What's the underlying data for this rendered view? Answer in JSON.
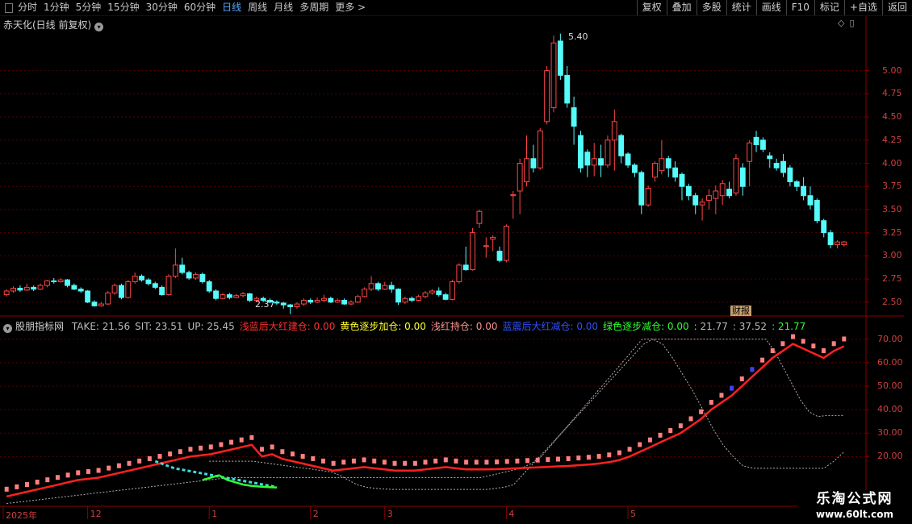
{
  "toolbar": {
    "periods": [
      {
        "label": "分时",
        "active": false
      },
      {
        "label": "1分钟",
        "active": false
      },
      {
        "label": "5分钟",
        "active": false
      },
      {
        "label": "15分钟",
        "active": false
      },
      {
        "label": "30分钟",
        "active": false
      },
      {
        "label": "60分钟",
        "active": false
      },
      {
        "label": "日线",
        "active": true
      },
      {
        "label": "周线",
        "active": false
      },
      {
        "label": "月线",
        "active": false
      },
      {
        "label": "多周期",
        "active": false
      },
      {
        "label": "更多 >",
        "active": false
      }
    ],
    "buttons": [
      "复权",
      "叠加",
      "多股",
      "统计",
      "画线",
      "F10",
      "标记",
      "+自选",
      "返回"
    ]
  },
  "main_pane": {
    "title": "赤天化(日线 前复权)",
    "high_mark": "5.40",
    "low_mark": "2.37",
    "fin_tag": "财报"
  },
  "indicator_pane": {
    "name": "股朋指标网",
    "items": [
      {
        "text": "TAKE: 21.56",
        "color": "#bbbbbb"
      },
      {
        "text": "SIT: 23.51",
        "color": "#bbbbbb"
      },
      {
        "text": "UP: 25.45",
        "color": "#bbbbbb"
      },
      {
        "text": "浅蓝后大红建仓: 0.00",
        "color": "#ff3030"
      },
      {
        "text": "黄色逐步加仓: 0.00",
        "color": "#ffff30"
      },
      {
        "text": "浅红持仓: 0.00",
        "color": "#ff9090"
      },
      {
        "text": "蓝震后大红减仓: 0.00",
        "color": "#3050ff"
      },
      {
        "text": "绿色逐步减仓: 0.00",
        "color": "#30ff30"
      },
      {
        "text": ": 21.77",
        "color": "#bbbbbb"
      },
      {
        "text": ": 37.52",
        "color": "#bbbbbb"
      },
      {
        "text": ": 21.77",
        "color": "#30ff30"
      }
    ]
  },
  "price_axis": [
    "5.00",
    "4.75",
    "4.50",
    "4.25",
    "4.00",
    "3.75",
    "3.50",
    "3.25",
    "3.00",
    "2.75",
    "2.50"
  ],
  "indicator_axis": [
    "70.00",
    "60.00",
    "50.00",
    "40.00",
    "30.00",
    "20.00"
  ],
  "date_axis": [
    {
      "label": "2025年"
    },
    {
      "label": "12"
    },
    {
      "label": "1"
    },
    {
      "label": "2"
    },
    {
      "label": "3"
    },
    {
      "label": "4"
    },
    {
      "label": "5"
    }
  ],
  "watermark": {
    "title": "乐淘公式网",
    "url": "www.60lt.com"
  },
  "colors": {
    "up": "#ff4545",
    "down": "#54fcfc",
    "grid": "#5a0000",
    "frame": "#8b0000"
  },
  "chart_data": {
    "type": "candlestick",
    "ylim": [
      2.35,
      5.45
    ],
    "bars": [
      {
        "o": 2.58,
        "c": 2.62,
        "h": 2.64,
        "l": 2.56
      },
      {
        "o": 2.62,
        "c": 2.65,
        "h": 2.67,
        "l": 2.6
      },
      {
        "o": 2.65,
        "c": 2.63,
        "h": 2.68,
        "l": 2.61
      },
      {
        "o": 2.63,
        "c": 2.66,
        "h": 2.7,
        "l": 2.62
      },
      {
        "o": 2.66,
        "c": 2.64,
        "h": 2.68,
        "l": 2.62
      },
      {
        "o": 2.64,
        "c": 2.68,
        "h": 2.7,
        "l": 2.63
      },
      {
        "o": 2.68,
        "c": 2.73,
        "h": 2.74,
        "l": 2.66
      },
      {
        "o": 2.73,
        "c": 2.72,
        "h": 2.76,
        "l": 2.7
      },
      {
        "o": 2.72,
        "c": 2.74,
        "h": 2.76,
        "l": 2.71
      },
      {
        "o": 2.74,
        "c": 2.68,
        "h": 2.75,
        "l": 2.66
      },
      {
        "o": 2.68,
        "c": 2.64,
        "h": 2.7,
        "l": 2.63
      },
      {
        "o": 2.64,
        "c": 2.62,
        "h": 2.66,
        "l": 2.6
      },
      {
        "o": 2.62,
        "c": 2.5,
        "h": 2.63,
        "l": 2.49
      },
      {
        "o": 2.5,
        "c": 2.46,
        "h": 2.52,
        "l": 2.45
      },
      {
        "o": 2.46,
        "c": 2.48,
        "h": 2.5,
        "l": 2.45
      },
      {
        "o": 2.48,
        "c": 2.6,
        "h": 2.62,
        "l": 2.47
      },
      {
        "o": 2.6,
        "c": 2.68,
        "h": 2.7,
        "l": 2.58
      },
      {
        "o": 2.68,
        "c": 2.55,
        "h": 2.7,
        "l": 2.53
      },
      {
        "o": 2.55,
        "c": 2.72,
        "h": 2.74,
        "l": 2.54
      },
      {
        "o": 2.72,
        "c": 2.78,
        "h": 2.82,
        "l": 2.7
      },
      {
        "o": 2.78,
        "c": 2.74,
        "h": 2.8,
        "l": 2.72
      },
      {
        "o": 2.74,
        "c": 2.7,
        "h": 2.76,
        "l": 2.68
      },
      {
        "o": 2.7,
        "c": 2.66,
        "h": 2.72,
        "l": 2.64
      },
      {
        "o": 2.66,
        "c": 2.58,
        "h": 2.68,
        "l": 2.57
      },
      {
        "o": 2.58,
        "c": 2.78,
        "h": 2.8,
        "l": 2.57
      },
      {
        "o": 2.78,
        "c": 2.9,
        "h": 3.08,
        "l": 2.76
      },
      {
        "o": 2.9,
        "c": 2.82,
        "h": 2.98,
        "l": 2.8
      },
      {
        "o": 2.82,
        "c": 2.76,
        "h": 2.84,
        "l": 2.74
      },
      {
        "o": 2.76,
        "c": 2.8,
        "h": 2.82,
        "l": 2.74
      },
      {
        "o": 2.8,
        "c": 2.72,
        "h": 2.82,
        "l": 2.7
      },
      {
        "o": 2.72,
        "c": 2.62,
        "h": 2.74,
        "l": 2.6
      },
      {
        "o": 2.62,
        "c": 2.54,
        "h": 2.64,
        "l": 2.52
      },
      {
        "o": 2.54,
        "c": 2.58,
        "h": 2.6,
        "l": 2.53
      },
      {
        "o": 2.58,
        "c": 2.55,
        "h": 2.6,
        "l": 2.53
      },
      {
        "o": 2.55,
        "c": 2.57,
        "h": 2.59,
        "l": 2.54
      },
      {
        "o": 2.57,
        "c": 2.59,
        "h": 2.61,
        "l": 2.55
      },
      {
        "o": 2.59,
        "c": 2.52,
        "h": 2.6,
        "l": 2.5
      },
      {
        "o": 2.52,
        "c": 2.54,
        "h": 2.56,
        "l": 2.5
      },
      {
        "o": 2.54,
        "c": 2.52,
        "h": 2.56,
        "l": 2.5
      },
      {
        "o": 2.52,
        "c": 2.5,
        "h": 2.54,
        "l": 2.49
      },
      {
        "o": 2.5,
        "c": 2.49,
        "h": 2.52,
        "l": 2.47
      },
      {
        "o": 2.49,
        "c": 2.47,
        "h": 2.5,
        "l": 2.43
      },
      {
        "o": 2.47,
        "c": 2.45,
        "h": 2.48,
        "l": 2.37
      },
      {
        "o": 2.45,
        "c": 2.48,
        "h": 2.5,
        "l": 2.43
      },
      {
        "o": 2.48,
        "c": 2.52,
        "h": 2.54,
        "l": 2.46
      },
      {
        "o": 2.52,
        "c": 2.5,
        "h": 2.54,
        "l": 2.48
      },
      {
        "o": 2.5,
        "c": 2.52,
        "h": 2.55,
        "l": 2.49
      },
      {
        "o": 2.52,
        "c": 2.54,
        "h": 2.58,
        "l": 2.5
      },
      {
        "o": 2.54,
        "c": 2.5,
        "h": 2.56,
        "l": 2.49
      },
      {
        "o": 2.5,
        "c": 2.52,
        "h": 2.54,
        "l": 2.49
      },
      {
        "o": 2.52,
        "c": 2.48,
        "h": 2.54,
        "l": 2.47
      },
      {
        "o": 2.48,
        "c": 2.5,
        "h": 2.52,
        "l": 2.47
      },
      {
        "o": 2.5,
        "c": 2.56,
        "h": 2.58,
        "l": 2.49
      },
      {
        "o": 2.56,
        "c": 2.64,
        "h": 2.66,
        "l": 2.55
      },
      {
        "o": 2.64,
        "c": 2.7,
        "h": 2.78,
        "l": 2.62
      },
      {
        "o": 2.7,
        "c": 2.64,
        "h": 2.72,
        "l": 2.62
      },
      {
        "o": 2.64,
        "c": 2.68,
        "h": 2.72,
        "l": 2.63
      },
      {
        "o": 2.68,
        "c": 2.64,
        "h": 2.72,
        "l": 2.6
      },
      {
        "o": 2.64,
        "c": 2.5,
        "h": 2.65,
        "l": 2.47
      },
      {
        "o": 2.5,
        "c": 2.54,
        "h": 2.56,
        "l": 2.48
      },
      {
        "o": 2.54,
        "c": 2.52,
        "h": 2.56,
        "l": 2.5
      },
      {
        "o": 2.52,
        "c": 2.56,
        "h": 2.58,
        "l": 2.51
      },
      {
        "o": 2.56,
        "c": 2.6,
        "h": 2.62,
        "l": 2.54
      },
      {
        "o": 2.6,
        "c": 2.62,
        "h": 2.64,
        "l": 2.58
      },
      {
        "o": 2.62,
        "c": 2.58,
        "h": 2.66,
        "l": 2.56
      },
      {
        "o": 2.58,
        "c": 2.53,
        "h": 2.6,
        "l": 2.52
      },
      {
        "o": 2.53,
        "c": 2.72,
        "h": 2.74,
        "l": 2.52
      },
      {
        "o": 2.72,
        "c": 2.9,
        "h": 2.92,
        "l": 2.7
      },
      {
        "o": 2.9,
        "c": 2.85,
        "h": 3.1,
        "l": 2.84
      },
      {
        "o": 2.85,
        "c": 3.25,
        "h": 3.3,
        "l": 2.84
      },
      {
        "o": 3.35,
        "c": 3.48,
        "h": 3.5,
        "l": 3.3
      },
      {
        "o": 3.1,
        "c": 3.11,
        "h": 3.2,
        "l": 2.98
      },
      {
        "o": 3.18,
        "c": 3.2,
        "h": 3.22,
        "l": 3.05
      },
      {
        "o": 3.05,
        "c": 2.95,
        "h": 3.1,
        "l": 2.93
      },
      {
        "o": 2.95,
        "c": 3.32,
        "h": 3.34,
        "l": 2.93
      },
      {
        "o": 3.65,
        "c": 3.66,
        "h": 3.7,
        "l": 3.4
      },
      {
        "o": 3.7,
        "c": 4.0,
        "h": 4.05,
        "l": 3.45
      },
      {
        "o": 3.8,
        "c": 4.05,
        "h": 4.3,
        "l": 3.75
      },
      {
        "o": 4.05,
        "c": 3.95,
        "h": 4.2,
        "l": 3.9
      },
      {
        "o": 3.95,
        "c": 4.35,
        "h": 4.38,
        "l": 3.93
      },
      {
        "o": 4.45,
        "c": 5.0,
        "h": 5.05,
        "l": 4.42
      },
      {
        "o": 4.6,
        "c": 5.3,
        "h": 5.38,
        "l": 4.55
      },
      {
        "o": 5.32,
        "c": 4.95,
        "h": 5.4,
        "l": 4.9
      },
      {
        "o": 4.95,
        "c": 4.65,
        "h": 5.05,
        "l": 4.6
      },
      {
        "o": 4.6,
        "c": 4.4,
        "h": 4.72,
        "l": 4.2
      },
      {
        "o": 4.3,
        "c": 3.95,
        "h": 4.35,
        "l": 3.9
      },
      {
        "o": 4.12,
        "c": 3.98,
        "h": 4.15,
        "l": 3.85
      },
      {
        "o": 3.98,
        "c": 4.05,
        "h": 4.22,
        "l": 3.86
      },
      {
        "o": 4.05,
        "c": 3.98,
        "h": 4.2,
        "l": 3.85
      },
      {
        "o": 3.98,
        "c": 4.25,
        "h": 4.3,
        "l": 3.95
      },
      {
        "o": 4.25,
        "c": 4.45,
        "h": 4.58,
        "l": 3.92
      },
      {
        "o": 4.3,
        "c": 4.08,
        "h": 4.32,
        "l": 4.0
      },
      {
        "o": 4.1,
        "c": 3.98,
        "h": 4.12,
        "l": 3.95
      },
      {
        "o": 3.98,
        "c": 3.9,
        "h": 4.0,
        "l": 3.85
      },
      {
        "o": 3.9,
        "c": 3.55,
        "h": 3.92,
        "l": 3.45
      },
      {
        "o": 3.55,
        "c": 3.73,
        "h": 3.76,
        "l": 3.53
      },
      {
        "o": 3.85,
        "c": 4.0,
        "h": 4.02,
        "l": 3.8
      },
      {
        "o": 3.92,
        "c": 4.05,
        "h": 4.25,
        "l": 3.88
      },
      {
        "o": 4.05,
        "c": 3.95,
        "h": 4.08,
        "l": 3.85
      },
      {
        "o": 3.95,
        "c": 3.85,
        "h": 4.02,
        "l": 3.8
      },
      {
        "o": 3.88,
        "c": 3.75,
        "h": 3.9,
        "l": 3.6
      },
      {
        "o": 3.75,
        "c": 3.65,
        "h": 3.78,
        "l": 3.6
      },
      {
        "o": 3.65,
        "c": 3.55,
        "h": 3.68,
        "l": 3.45
      },
      {
        "o": 3.55,
        "c": 3.58,
        "h": 3.62,
        "l": 3.38
      },
      {
        "o": 3.6,
        "c": 3.65,
        "h": 3.72,
        "l": 3.5
      },
      {
        "o": 3.62,
        "c": 3.7,
        "h": 3.76,
        "l": 3.45
      },
      {
        "o": 3.65,
        "c": 3.78,
        "h": 3.82,
        "l": 3.55
      },
      {
        "o": 3.72,
        "c": 3.65,
        "h": 3.8,
        "l": 3.62
      },
      {
        "o": 3.68,
        "c": 4.05,
        "h": 4.1,
        "l": 3.65
      },
      {
        "o": 3.95,
        "c": 3.75,
        "h": 4.0,
        "l": 3.65
      },
      {
        "o": 4.02,
        "c": 4.22,
        "h": 4.25,
        "l": 3.75
      },
      {
        "o": 4.28,
        "c": 4.2,
        "h": 4.35,
        "l": 4.12
      },
      {
        "o": 4.25,
        "c": 4.15,
        "h": 4.28,
        "l": 4.12
      },
      {
        "o": 4.08,
        "c": 4.05,
        "h": 4.12,
        "l": 3.95
      },
      {
        "o": 4.0,
        "c": 3.95,
        "h": 4.05,
        "l": 3.92
      },
      {
        "o": 4.02,
        "c": 3.9,
        "h": 4.1,
        "l": 3.85
      },
      {
        "o": 3.95,
        "c": 3.8,
        "h": 3.98,
        "l": 3.75
      },
      {
        "o": 3.8,
        "c": 3.75,
        "h": 3.82,
        "l": 3.7
      },
      {
        "o": 3.75,
        "c": 3.65,
        "h": 3.85,
        "l": 3.6
      },
      {
        "o": 3.65,
        "c": 3.55,
        "h": 3.75,
        "l": 3.5
      },
      {
        "o": 3.6,
        "c": 3.38,
        "h": 3.62,
        "l": 3.35
      },
      {
        "o": 3.38,
        "c": 3.25,
        "h": 3.4,
        "l": 3.2
      },
      {
        "o": 3.25,
        "c": 3.12,
        "h": 3.28,
        "l": 3.08
      },
      {
        "o": 3.12,
        "c": 3.15,
        "h": 3.17,
        "l": 3.08
      },
      {
        "o": 3.12,
        "c": 3.15,
        "h": 3.16,
        "l": 3.1
      }
    ],
    "indicator": {
      "ylim": [
        -0.5,
        73
      ],
      "red_line": [
        3,
        4,
        5,
        6,
        7,
        8,
        9,
        10,
        10.5,
        11,
        12,
        13,
        14,
        15,
        16,
        17,
        18,
        19,
        20,
        20.5,
        21,
        22,
        23,
        24,
        25,
        20,
        21,
        19,
        18,
        17,
        16,
        15,
        14,
        14.5,
        15,
        15.5,
        15,
        14.5,
        14,
        14,
        14,
        14.5,
        15,
        15.5,
        15,
        14.5,
        14.5,
        14.5,
        14.6,
        14.8,
        15,
        15.2,
        15.4,
        15.6,
        15.8,
        16,
        16.3,
        16.6,
        17,
        17.6,
        18.5,
        20,
        22,
        24,
        26,
        28,
        30,
        33,
        36,
        40,
        43,
        46,
        50,
        54,
        58,
        62,
        65,
        68,
        66,
        64,
        62,
        65,
        67
      ],
      "cyan_line": [
        18,
        17,
        16,
        15,
        14.5,
        14,
        13.5,
        13,
        12.5,
        12,
        11.5,
        11,
        10.5,
        10,
        9.5,
        9,
        8.5,
        8,
        7.5,
        7
      ],
      "green_line": [
        10,
        11,
        12,
        10,
        9,
        8,
        7.5,
        7.2,
        7,
        6.8
      ],
      "upper_band": [
        18,
        18,
        18,
        18,
        18,
        18,
        17.5,
        17,
        16.5,
        16,
        15.5,
        15,
        14.5,
        14,
        13.5,
        12,
        10,
        8,
        7,
        6.5,
        6.2,
        6,
        6,
        6,
        6,
        6,
        6,
        6,
        6,
        6,
        6,
        6,
        6,
        6.5,
        7,
        8,
        12,
        16,
        20,
        24,
        28,
        32,
        36,
        40,
        44,
        48,
        52,
        56,
        60,
        64,
        68,
        70,
        70,
        70,
        70,
        70,
        70,
        70,
        70,
        70,
        70,
        70,
        70,
        70,
        70,
        65,
        58,
        51,
        44,
        39,
        37,
        37.5,
        37.5,
        37.5
      ],
      "lower_band": [
        0,
        0.5,
        1,
        1.5,
        2,
        2.5,
        3,
        3.5,
        4,
        4.5,
        5,
        5.5,
        6,
        6.5,
        7,
        7.5,
        8,
        8.5,
        9,
        9.5,
        10,
        10.5,
        11,
        11,
        11,
        11,
        11,
        11,
        11,
        11,
        11,
        11,
        11,
        11,
        11,
        11,
        11,
        11,
        11,
        11,
        11,
        11,
        11,
        11,
        11,
        11,
        11,
        11,
        12,
        13,
        14,
        15,
        17,
        20,
        25,
        30,
        35,
        40,
        45,
        50,
        55,
        60,
        65,
        70,
        70,
        68,
        62,
        55,
        48,
        40,
        32,
        25,
        20,
        16,
        15,
        15,
        15,
        15,
        15,
        15,
        15,
        15,
        18,
        22
      ]
    }
  }
}
